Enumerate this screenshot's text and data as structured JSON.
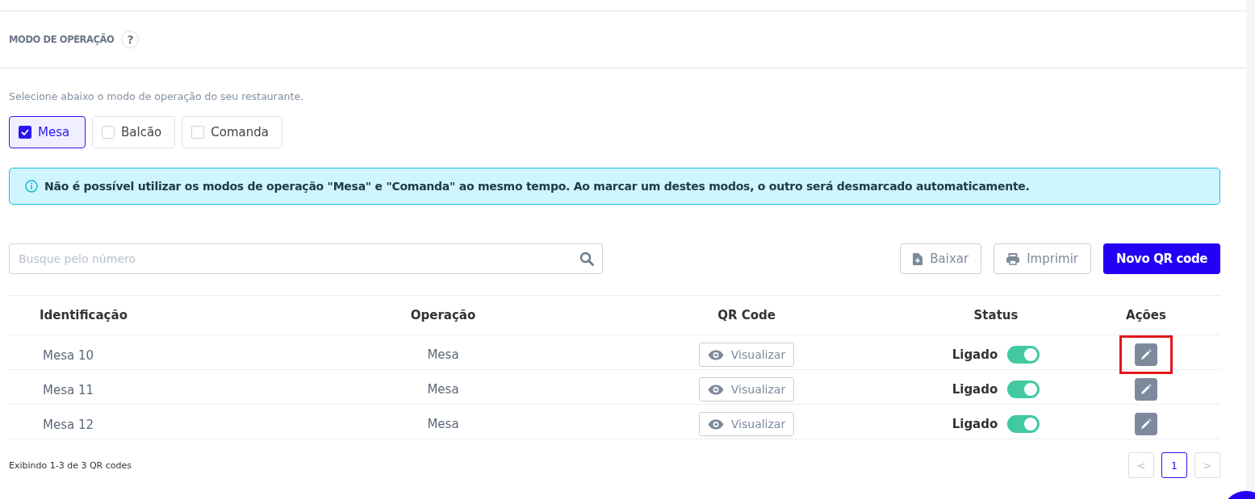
{
  "section": {
    "title": "MODO DE OPERAÇÃO",
    "help": "?"
  },
  "description": "Selecione abaixo o modo de operação do seu restaurante.",
  "modes": [
    {
      "label": "Mesa",
      "checked": true
    },
    {
      "label": "Balcão",
      "checked": false
    },
    {
      "label": "Comanda",
      "checked": false
    }
  ],
  "alert": "Não é possível utilizar os modos de operação \"Mesa\" e \"Comanda\" ao mesmo tempo. Ao marcar um destes modos, o outro será desmarcado automaticamente.",
  "search": {
    "placeholder": "Busque pelo número"
  },
  "buttons": [
    {
      "label": "Baixar",
      "kind": "download"
    },
    {
      "label": "Imprimir",
      "kind": "print"
    },
    {
      "label": "Novo QR code",
      "kind": "primary"
    }
  ],
  "table": {
    "columns": [
      "Identificação",
      "Operação",
      "QR Code",
      "Status",
      "Ações"
    ],
    "rows": [
      {
        "id": "Mesa 10",
        "operation": "Mesa",
        "qr": "Visualizar",
        "status": "Ligado",
        "on": true,
        "highlighted": true
      },
      {
        "id": "Mesa 11",
        "operation": "Mesa",
        "qr": "Visualizar",
        "status": "Ligado",
        "on": true,
        "highlighted": false
      },
      {
        "id": "Mesa 12",
        "operation": "Mesa",
        "qr": "Visualizar",
        "status": "Ligado",
        "on": true,
        "highlighted": false
      }
    ]
  },
  "footer": "Exibindo 1-3 de 3 QR codes",
  "pagination": {
    "prev": "<",
    "pages": [
      {
        "label": "1",
        "selected": true
      }
    ],
    "next": ">"
  }
}
